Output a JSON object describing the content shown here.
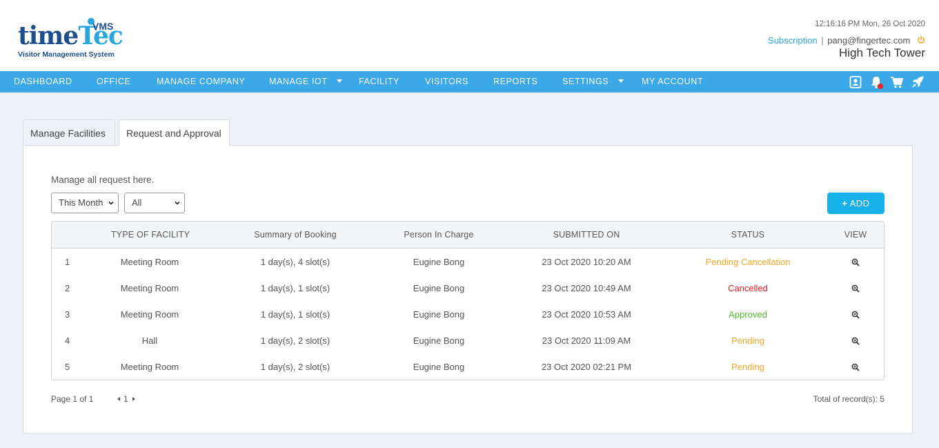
{
  "header": {
    "logo": {
      "time": "time",
      "tec": "Tec",
      "vms": "VMS",
      "subtitle": "Visitor Management System"
    },
    "datetime": "12:16:16 PM  Mon, 26 Oct 2020",
    "subscription_label": "Subscription",
    "separator": "|",
    "user_email": "pang@fingertec.com",
    "building": "High Tech Tower"
  },
  "nav": {
    "items": [
      {
        "label": "DASHBOARD"
      },
      {
        "label": "OFFICE"
      },
      {
        "label": "MANAGE COMPANY"
      },
      {
        "label": "MANAGE IOT"
      },
      {
        "label": "FACILITY"
      },
      {
        "label": "VISITORS"
      },
      {
        "label": "REPORTS"
      },
      {
        "label": "SETTINGS"
      },
      {
        "label": "MY ACCOUNT"
      }
    ],
    "icons": [
      "contact-card-icon",
      "notification-bell-icon",
      "shopping-cart-icon",
      "rocket-icon"
    ]
  },
  "tabs": [
    {
      "label": "Manage Facilities",
      "active": false
    },
    {
      "label": "Request and Approval",
      "active": true
    }
  ],
  "panel": {
    "description": "Manage all request here.",
    "period_filter": {
      "selected": "This Month"
    },
    "status_filter": {
      "selected": "All"
    },
    "add_button": "ADD"
  },
  "table": {
    "columns": [
      "",
      "TYPE OF FACILITY",
      "Summary of Booking",
      "Person In Charge",
      "SUBMITTED ON",
      "STATUS",
      "VIEW"
    ],
    "rows": [
      {
        "no": "1",
        "facility": "Meeting Room",
        "summary": "1 day(s), 4 slot(s)",
        "person": "Eugine Bong",
        "submitted": "23 Oct 2020 10:20 AM",
        "status": "Pending Cancellation",
        "status_color": "#f5a623"
      },
      {
        "no": "2",
        "facility": "Meeting Room",
        "summary": "1 day(s), 1 slot(s)",
        "person": "Eugine Bong",
        "submitted": "23 Oct 2020 10:49 AM",
        "status": "Cancelled",
        "status_color": "#e02020"
      },
      {
        "no": "3",
        "facility": "Meeting Room",
        "summary": "1 day(s), 1 slot(s)",
        "person": "Eugine Bong",
        "submitted": "23 Oct 2020 10:53 AM",
        "status": "Approved",
        "status_color": "#4cbf2a"
      },
      {
        "no": "4",
        "facility": "Hall",
        "summary": "1 day(s), 2 slot(s)",
        "person": "Eugine Bong",
        "submitted": "23 Oct 2020 11:09 AM",
        "status": "Pending",
        "status_color": "#f5a623"
      },
      {
        "no": "5",
        "facility": "Meeting Room",
        "summary": "1 day(s), 2 slot(s)",
        "person": "Eugine Bong",
        "submitted": "23 Oct 2020 02:21 PM",
        "status": "Pending",
        "status_color": "#f5a623"
      }
    ]
  },
  "footer": {
    "page_info": "Page 1 of 1",
    "current_page": "1",
    "total_records": "Total of record(s): 5"
  },
  "colors": {
    "nav_bg": "#3ba8e8",
    "accent": "#17b1ea",
    "brand_dark": "#1d4f8c",
    "brand_light": "#2aa6de",
    "power_icon": "#f5a623"
  }
}
